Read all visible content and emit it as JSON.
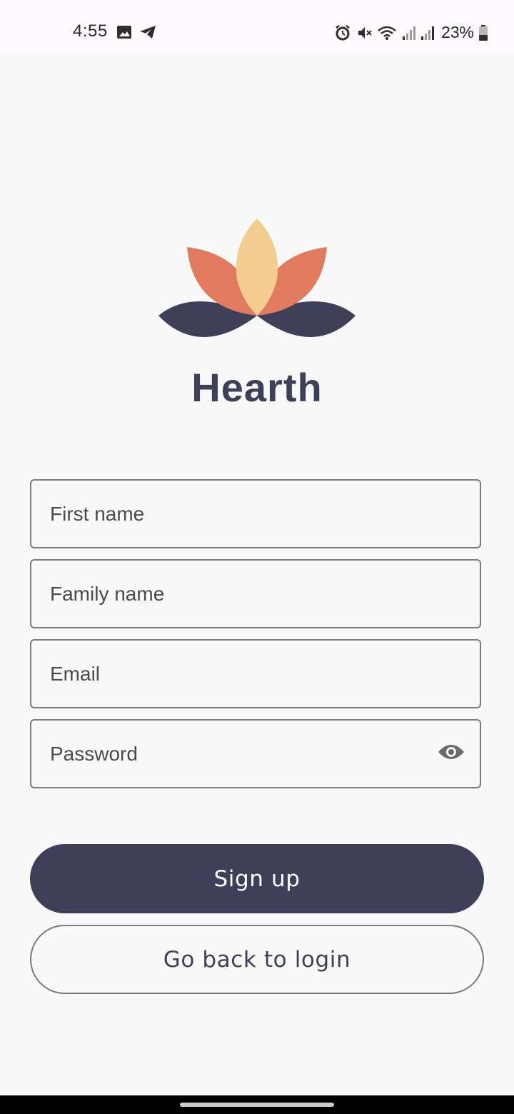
{
  "status_bar": {
    "time": "4:55",
    "battery": "23%",
    "left_icons": [
      "image-icon",
      "telegram-icon"
    ],
    "right_icons": [
      "alarm-icon",
      "mute-icon",
      "wifi-icon",
      "signal-icon",
      "signal-icon",
      "battery-icon"
    ]
  },
  "app": {
    "name": "Hearth",
    "colors": {
      "primary": "#3e4059",
      "petal_orange": "#e27a5e",
      "petal_yellow": "#f3cd8f"
    }
  },
  "form": {
    "first_name_placeholder": "First name",
    "family_name_placeholder": "Family name",
    "email_placeholder": "Email",
    "password_placeholder": "Password"
  },
  "buttons": {
    "signup_label": "Sign up",
    "back_to_login_label": "Go back to login"
  }
}
